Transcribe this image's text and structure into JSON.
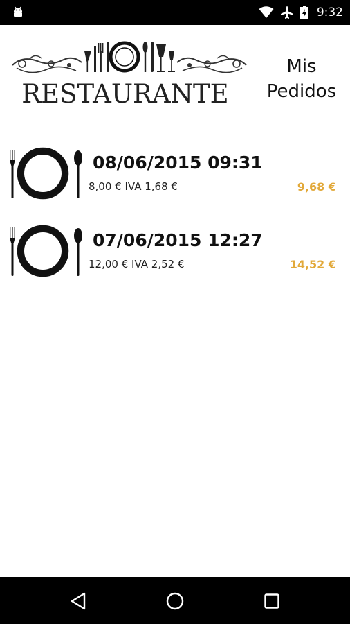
{
  "status_bar": {
    "time": "9:32",
    "icons": [
      "android-icon",
      "wifi-icon",
      "airplane-icon",
      "battery-charging-icon"
    ]
  },
  "header": {
    "logo_text": "RESTAURANTE",
    "title_line1": "Mis",
    "title_line2": "Pedidos"
  },
  "orders": [
    {
      "date": "08/06/2015 09:31",
      "detail": "8,00 € IVA 1,68 €",
      "total": "9,68 €"
    },
    {
      "date": "07/06/2015 12:27",
      "detail": "12,00 € IVA 2,52 €",
      "total": "14,52 €"
    }
  ],
  "nav_bar": {
    "buttons": [
      "back-icon",
      "home-icon",
      "recents-icon"
    ]
  },
  "colors": {
    "total_accent": "#e2a93a",
    "bars": "#000000"
  }
}
